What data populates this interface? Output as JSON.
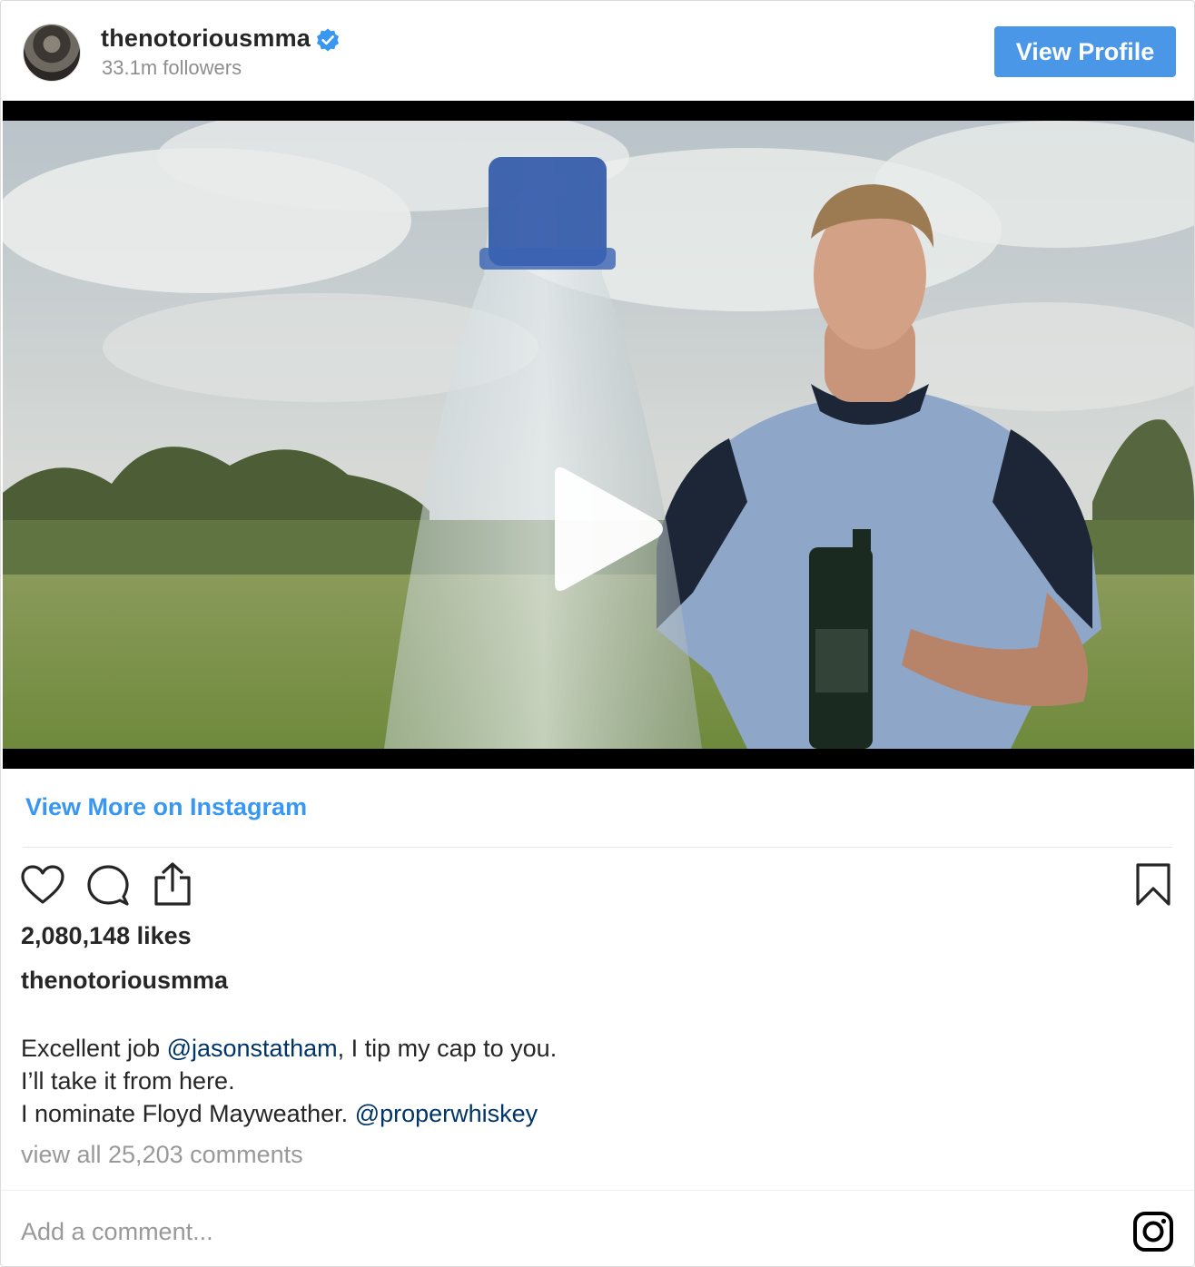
{
  "header": {
    "username": "thenotoriousmma",
    "followers": "33.1m followers",
    "view_profile_label": "View Profile"
  },
  "post": {
    "view_more_label": "View More on Instagram",
    "likes": "2,080,148 likes",
    "author": "thenotoriousmma",
    "caption": {
      "line1_pre": "Excellent job ",
      "line1_mention": "@jasonstatham",
      "line1_post": ", I tip my cap to you.",
      "line2": "I’ll take it from here.",
      "line3_pre": "I nominate Floyd Mayweather. ",
      "line3_mention": "@properwhiskey"
    },
    "comments_link": "view all 25,203 comments",
    "comment_placeholder": "Add a comment..."
  },
  "icons": {
    "verified": "verified-badge-icon",
    "play": "play-icon",
    "like": "heart-icon",
    "comment": "speech-bubble-icon",
    "share": "share-upload-icon",
    "save": "bookmark-icon",
    "instagram": "instagram-logo-icon"
  },
  "colors": {
    "accent": "#3897f0",
    "button": "#4a97e8",
    "mention": "#003569",
    "muted": "#8e8e8e"
  }
}
